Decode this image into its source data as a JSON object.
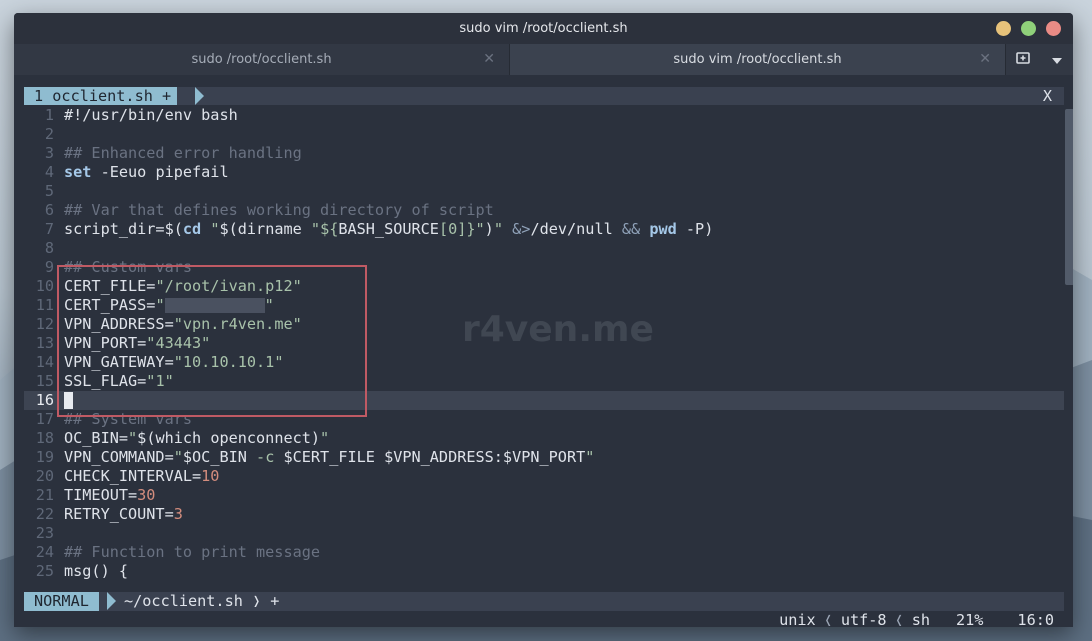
{
  "window": {
    "title": "sudo vim /root/occlient.sh"
  },
  "tabs": [
    {
      "label": "sudo /root/occlient.sh",
      "active": false
    },
    {
      "label": "sudo vim /root/occlient.sh",
      "active": true
    }
  ],
  "colors": {
    "close": "#e7c27a",
    "min": "#8fd07a",
    "max": "#ea8b85",
    "accent": "#8fbcd0",
    "highlight_box": "#c05a64"
  },
  "icons": {
    "new_tab": "new-tab-icon",
    "menu": "dropdown-icon"
  },
  "buffer": {
    "label": "1 occlient.sh +",
    "close": "X"
  },
  "watermark": "r4ven.me",
  "code": {
    "lines": [
      {
        "n": "1",
        "html": "#!/usr/bin/env bash"
      },
      {
        "n": "2",
        "html": ""
      },
      {
        "n": "3",
        "html": "<span class=\"cm\">## Enhanced error handling</span>"
      },
      {
        "n": "4",
        "html": "<span class=\"kw\">set</span> -Eeuo pipefail"
      },
      {
        "n": "5",
        "html": ""
      },
      {
        "n": "6",
        "html": "<span class=\"cm\">## Var that defines working directory of script</span>"
      },
      {
        "n": "7",
        "html": "script_dir=$(<span class=\"kw\">cd</span> <span class=\"st\">\"</span>$(dirname <span class=\"st\">\"${</span>BASH_SOURCE<span class=\"st\">[0]}\"</span>)<span class=\"st\">\"</span> <span class=\"op\">&amp;&gt;</span>/dev/null <span class=\"op\">&amp;&amp;</span> <span class=\"kw\">pwd</span> -P)"
      },
      {
        "n": "8",
        "html": ""
      },
      {
        "n": "9",
        "html": "<span class=\"cm\">## Custom vars</span>"
      },
      {
        "n": "10",
        "html": "CERT_FILE=<span class=\"st\">\"/root/ivan.p12\"</span>"
      },
      {
        "n": "11",
        "html": "CERT_PASS=<span class=\"st\">\"</span><span style=\"display:inline-block;width:100px;height:15px;background:#4a5160;vertical-align:middle\"></span><span class=\"st\">\"</span>"
      },
      {
        "n": "12",
        "html": "VPN_ADDRESS=<span class=\"st\">\"vpn.r4ven.me\"</span>"
      },
      {
        "n": "13",
        "html": "VPN_PORT=<span class=\"st\">\"43443\"</span>"
      },
      {
        "n": "14",
        "html": "VPN_GATEWAY=<span class=\"st\">\"10.10.10.1\"</span>"
      },
      {
        "n": "15",
        "html": "SSL_FLAG=<span class=\"st\">\"1\"</span>"
      },
      {
        "n": "16",
        "html": "<span class=\"cursor\"></span>",
        "current": true
      },
      {
        "n": "17",
        "html": "<span class=\"cm\">## System vars</span>"
      },
      {
        "n": "18",
        "html": "OC_BIN=<span class=\"st\">\"</span>$(which openconnect)<span class=\"st\">\"</span>"
      },
      {
        "n": "19",
        "html": "VPN_COMMAND=<span class=\"st\">\"</span>$OC_BIN <span class=\"st\">-c</span> $CERT_FILE $VPN_ADDRESS:$VPN_PORT<span class=\"st\">\"</span>"
      },
      {
        "n": "20",
        "html": "CHECK_INTERVAL=<span class=\"nm\">10</span>"
      },
      {
        "n": "21",
        "html": "TIMEOUT=<span class=\"nm\">30</span>"
      },
      {
        "n": "22",
        "html": "RETRY_COUNT=<span class=\"nm\">3</span>"
      },
      {
        "n": "23",
        "html": ""
      },
      {
        "n": "24",
        "html": "<span class=\"cm\">## Function to print message</span>"
      },
      {
        "n": "25",
        "html": "msg() {"
      }
    ]
  },
  "status": {
    "mode": "NORMAL",
    "file": "~/occlient.sh ❭ +",
    "format": "unix",
    "encoding": "utf-8",
    "filetype": "sh",
    "percent": "21%",
    "position": "16:0"
  }
}
